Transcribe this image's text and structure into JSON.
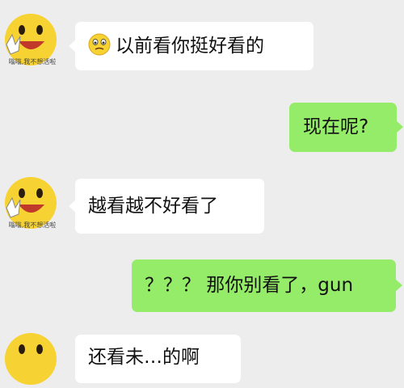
{
  "chat": {
    "avatar_caption": "嗡嗡,我不想活啦",
    "messages": [
      {
        "side": "in",
        "emoji": "worried-face-emoji",
        "text": "以前看你挺好看的"
      },
      {
        "side": "out",
        "text": "现在呢?"
      },
      {
        "side": "in",
        "text": "越看越不好看了"
      },
      {
        "side": "out",
        "text": "？？？ 那你别看了，gun"
      },
      {
        "side": "in",
        "text": "还看未…的啊"
      }
    ]
  },
  "colors": {
    "background": "#ededed",
    "incoming_bubble": "#ffffff",
    "outgoing_bubble": "#95ec69",
    "avatar_face": "#f7d233"
  },
  "icons": [
    "smiley-avatar-icon",
    "worried-face-emoji"
  ]
}
